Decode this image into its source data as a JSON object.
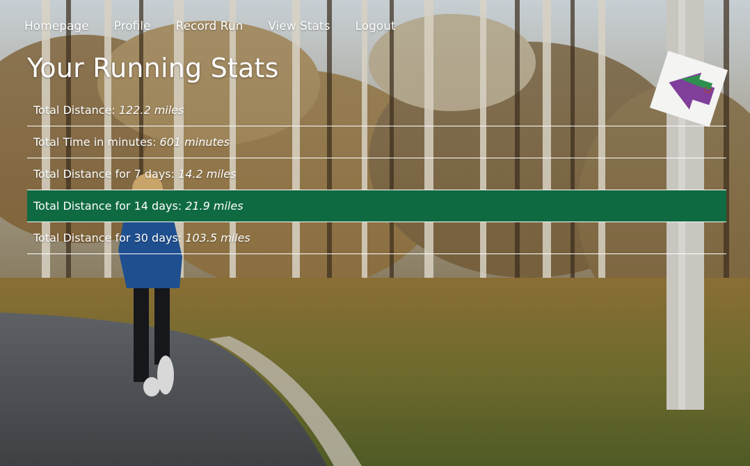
{
  "nav": {
    "items": [
      {
        "label": "Homepage"
      },
      {
        "label": "Profile"
      },
      {
        "label": "Record Run"
      },
      {
        "label": "View Stats"
      },
      {
        "label": "Logout"
      }
    ]
  },
  "page": {
    "title": "Your Running Stats"
  },
  "stats": {
    "rows": [
      {
        "label": "Total Distance:",
        "value": "122.2 miles"
      },
      {
        "label": "Total Time in minutes:",
        "value": "601 minutes"
      },
      {
        "label": "Total Distance for 7 days:",
        "value": "14.2 miles"
      },
      {
        "label": "Total Distance for 14 days:",
        "value": "21.9 miles"
      },
      {
        "label": "Total Distance for 30 days:",
        "value": "103.5 miles"
      }
    ],
    "highlight_color": "#0f6a42"
  },
  "background": {
    "scene": "autumn forest trail with a runner on a paved path and a trail-marker pole",
    "colors": {
      "sky": "#cfd8dc",
      "foliage": "#8a6a3a",
      "path": "#55585c",
      "grass": "#6f6a2f"
    }
  }
}
